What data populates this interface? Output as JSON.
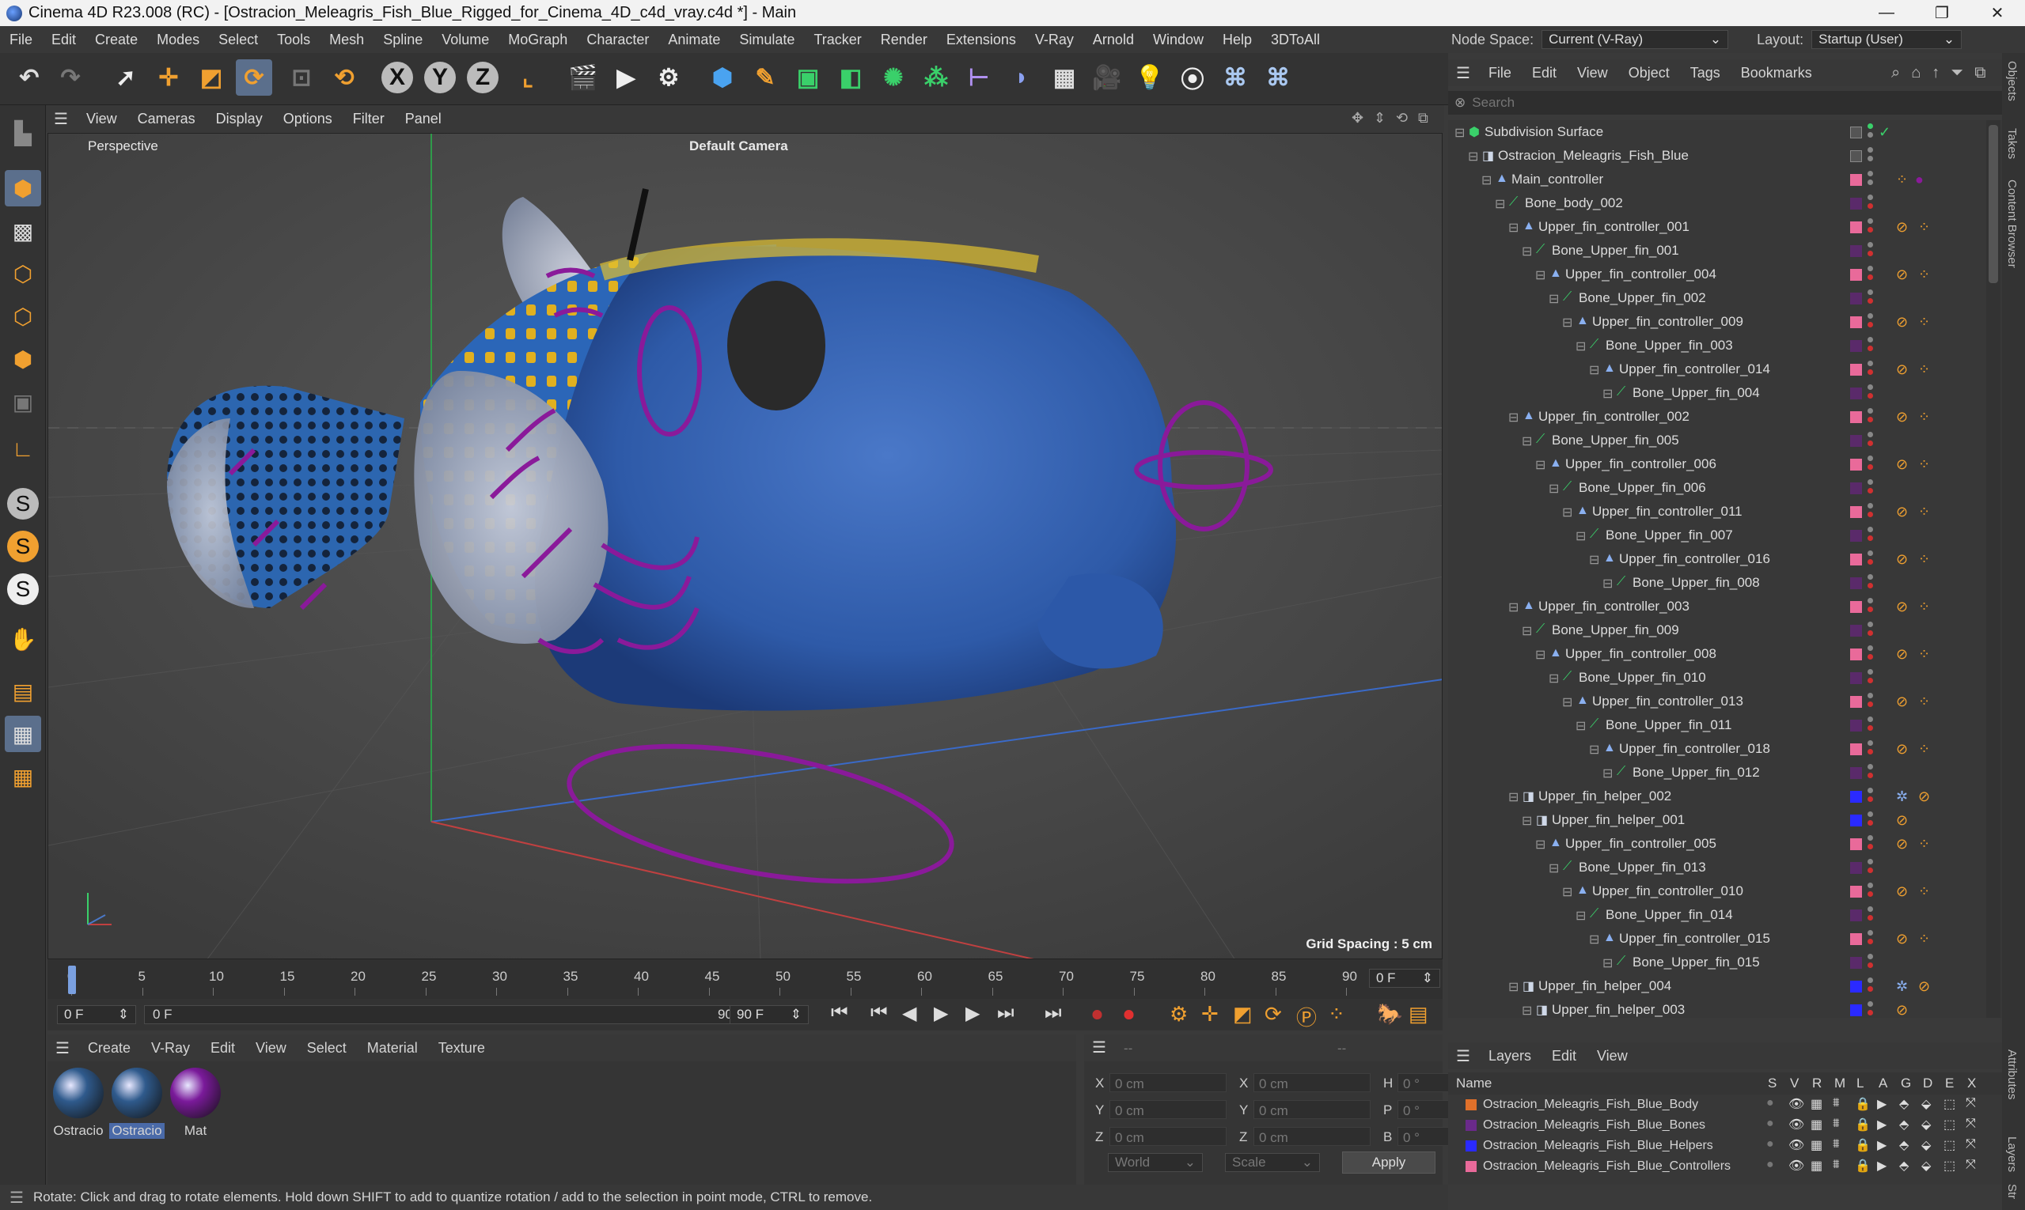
{
  "window": {
    "title": "Cinema 4D R23.008 (RC) - [Ostracion_Meleagris_Fish_Blue_Rigged_for_Cinema_4D_c4d_vray.c4d *] - Main",
    "minimize": "—",
    "maximize": "❐",
    "close": "✕"
  },
  "menubar": [
    "File",
    "Edit",
    "Create",
    "Modes",
    "Select",
    "Tools",
    "Mesh",
    "Spline",
    "Volume",
    "MoGraph",
    "Character",
    "Animate",
    "Simulate",
    "Tracker",
    "Render",
    "Extensions",
    "V-Ray",
    "Arnold",
    "Window",
    "Help",
    "3DToAll"
  ],
  "nodespace": {
    "label": "Node Space:",
    "value": "Current (V-Ray)",
    "layout_label": "Layout:",
    "layout_value": "Startup (User)"
  },
  "viewport": {
    "menu": [
      "View",
      "Cameras",
      "Display",
      "Options",
      "Filter",
      "Panel"
    ],
    "label": "Perspective",
    "camera": "Default Camera",
    "grid_spacing": "Grid Spacing : 5 cm"
  },
  "timeline": {
    "ticks": [
      "0",
      "5",
      "10",
      "15",
      "20",
      "25",
      "30",
      "35",
      "40",
      "45",
      "50",
      "55",
      "60",
      "65",
      "70",
      "75",
      "80",
      "85",
      "90"
    ],
    "current_frame": "0 F",
    "start_field": "0 F",
    "range_start": "0 F",
    "range_end": "90 F",
    "end_field": "90 F"
  },
  "material_manager": {
    "menu": [
      "Create",
      "V-Ray",
      "Edit",
      "View",
      "Select",
      "Material",
      "Texture"
    ],
    "materials": [
      {
        "name": "Ostracio",
        "color": "#2f5a8c"
      },
      {
        "name": "Ostracio",
        "color": "#2f5a8c"
      },
      {
        "name": "Mat",
        "color": "#7a1a9a"
      }
    ]
  },
  "coordinates": {
    "header_left": "--",
    "header_right": "--",
    "rows": [
      {
        "a": "X",
        "av": "0 cm",
        "b": "X",
        "bv": "0 cm",
        "c": "H",
        "cv": "0 °"
      },
      {
        "a": "Y",
        "av": "0 cm",
        "b": "Y",
        "bv": "0 cm",
        "c": "P",
        "cv": "0 °"
      },
      {
        "a": "Z",
        "av": "0 cm",
        "b": "Z",
        "bv": "0 cm",
        "c": "B",
        "cv": "0 °"
      }
    ],
    "world": "World",
    "scale": "Scale",
    "apply": "Apply"
  },
  "status": "Rotate: Click and drag to rotate elements. Hold down SHIFT to add to quantize rotation / add to the selection in point mode, CTRL to remove.",
  "object_manager": {
    "menu": [
      "File",
      "Edit",
      "View",
      "Object",
      "Tags",
      "Bookmarks"
    ],
    "search_placeholder": "Search",
    "objects": [
      {
        "name": "Subdivision Surface",
        "depth": 0,
        "type": "subdiv",
        "color": ""
      },
      {
        "name": "Ostracion_Meleagris_Fish_Blue",
        "depth": 1,
        "type": "null",
        "color": ""
      },
      {
        "name": "Main_controller",
        "depth": 2,
        "type": "ctrl",
        "color": "#e96a9a"
      },
      {
        "name": "Bone_body_002",
        "depth": 3,
        "type": "bone",
        "color": "#5a2a6a"
      },
      {
        "name": "Upper_fin_controller_001",
        "depth": 4,
        "type": "ctrl",
        "color": "#e96a9a"
      },
      {
        "name": "Bone_Upper_fin_001",
        "depth": 5,
        "type": "bone",
        "color": "#5a2a6a"
      },
      {
        "name": "Upper_fin_controller_004",
        "depth": 6,
        "type": "ctrl",
        "color": "#e96a9a"
      },
      {
        "name": "Bone_Upper_fin_002",
        "depth": 7,
        "type": "bone",
        "color": "#5a2a6a"
      },
      {
        "name": "Upper_fin_controller_009",
        "depth": 8,
        "type": "ctrl",
        "color": "#e96a9a"
      },
      {
        "name": "Bone_Upper_fin_003",
        "depth": 9,
        "type": "bone",
        "color": "#5a2a6a"
      },
      {
        "name": "Upper_fin_controller_014",
        "depth": 10,
        "type": "ctrl",
        "color": "#e96a9a"
      },
      {
        "name": "Bone_Upper_fin_004",
        "depth": 11,
        "type": "bone",
        "color": "#5a2a6a"
      },
      {
        "name": "Upper_fin_controller_002",
        "depth": 4,
        "type": "ctrl",
        "color": "#e96a9a"
      },
      {
        "name": "Bone_Upper_fin_005",
        "depth": 5,
        "type": "bone",
        "color": "#5a2a6a"
      },
      {
        "name": "Upper_fin_controller_006",
        "depth": 6,
        "type": "ctrl",
        "color": "#e96a9a"
      },
      {
        "name": "Bone_Upper_fin_006",
        "depth": 7,
        "type": "bone",
        "color": "#5a2a6a"
      },
      {
        "name": "Upper_fin_controller_011",
        "depth": 8,
        "type": "ctrl",
        "color": "#e96a9a"
      },
      {
        "name": "Bone_Upper_fin_007",
        "depth": 9,
        "type": "bone",
        "color": "#5a2a6a"
      },
      {
        "name": "Upper_fin_controller_016",
        "depth": 10,
        "type": "ctrl",
        "color": "#e96a9a"
      },
      {
        "name": "Bone_Upper_fin_008",
        "depth": 11,
        "type": "bone",
        "color": "#5a2a6a"
      },
      {
        "name": "Upper_fin_controller_003",
        "depth": 4,
        "type": "ctrl",
        "color": "#e96a9a"
      },
      {
        "name": "Bone_Upper_fin_009",
        "depth": 5,
        "type": "bone",
        "color": "#5a2a6a"
      },
      {
        "name": "Upper_fin_controller_008",
        "depth": 6,
        "type": "ctrl",
        "color": "#e96a9a"
      },
      {
        "name": "Bone_Upper_fin_010",
        "depth": 7,
        "type": "bone",
        "color": "#5a2a6a"
      },
      {
        "name": "Upper_fin_controller_013",
        "depth": 8,
        "type": "ctrl",
        "color": "#e96a9a"
      },
      {
        "name": "Bone_Upper_fin_011",
        "depth": 9,
        "type": "bone",
        "color": "#5a2a6a"
      },
      {
        "name": "Upper_fin_controller_018",
        "depth": 10,
        "type": "ctrl",
        "color": "#e96a9a"
      },
      {
        "name": "Bone_Upper_fin_012",
        "depth": 11,
        "type": "bone",
        "color": "#5a2a6a"
      },
      {
        "name": "Upper_fin_helper_002",
        "depth": 4,
        "type": "helper",
        "color": "#2a2aff"
      },
      {
        "name": "Upper_fin_helper_001",
        "depth": 5,
        "type": "helper",
        "color": "#2a2aff"
      },
      {
        "name": "Upper_fin_controller_005",
        "depth": 6,
        "type": "ctrl",
        "color": "#e96a9a"
      },
      {
        "name": "Bone_Upper_fin_013",
        "depth": 7,
        "type": "bone",
        "color": "#5a2a6a"
      },
      {
        "name": "Upper_fin_controller_010",
        "depth": 8,
        "type": "ctrl",
        "color": "#e96a9a"
      },
      {
        "name": "Bone_Upper_fin_014",
        "depth": 9,
        "type": "bone",
        "color": "#5a2a6a"
      },
      {
        "name": "Upper_fin_controller_015",
        "depth": 10,
        "type": "ctrl",
        "color": "#e96a9a"
      },
      {
        "name": "Bone_Upper_fin_015",
        "depth": 11,
        "type": "bone",
        "color": "#5a2a6a"
      },
      {
        "name": "Upper_fin_helper_004",
        "depth": 4,
        "type": "helper",
        "color": "#2a2aff"
      },
      {
        "name": "Upper_fin_helper_003",
        "depth": 5,
        "type": "helper",
        "color": "#2a2aff"
      }
    ]
  },
  "layers": {
    "menu": [
      "Layers",
      "Edit",
      "View"
    ],
    "columns": [
      "Name",
      "S",
      "V",
      "R",
      "M",
      "L",
      "A",
      "G",
      "D",
      "E",
      "X"
    ],
    "items": [
      {
        "name": "Ostracion_Meleagris_Fish_Blue_Body",
        "color": "#e0702a"
      },
      {
        "name": "Ostracion_Meleagris_Fish_Blue_Bones",
        "color": "#6a2a8a"
      },
      {
        "name": "Ostracion_Meleagris_Fish_Blue_Helpers",
        "color": "#2a2aff"
      },
      {
        "name": "Ostracion_Meleagris_Fish_Blue_Controllers",
        "color": "#e96a9a"
      }
    ]
  },
  "side_tabs": [
    "Objects",
    "Takes",
    "Content Browser",
    "Attributes",
    "Layers",
    "Str"
  ]
}
